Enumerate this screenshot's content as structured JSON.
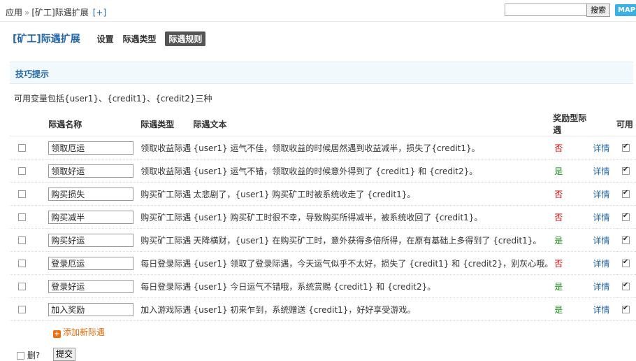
{
  "breadcrumb": {
    "root": "应用",
    "separator": "»",
    "current": "[矿工]际遇扩展",
    "add": "[+]"
  },
  "header": {
    "search_placeholder": "",
    "search_button": "搜索",
    "map_button": "MAP"
  },
  "page": {
    "title": "[矿工]际遇扩展",
    "nav": [
      {
        "label": "设置",
        "active": false
      },
      {
        "label": "际遇类型",
        "active": false
      },
      {
        "label": "际遇规则",
        "active": true
      }
    ]
  },
  "tips": {
    "heading": "技巧提示",
    "text": "可用变量包括{user1}、{credit1}、{credit2}三种"
  },
  "table": {
    "headers": {
      "name": "际遇名称",
      "type": "际遇类型",
      "text": "际遇文本",
      "reward": "奖励型际遇",
      "enabled": "可用"
    },
    "rows": [
      {
        "name": "领取厄运",
        "type": "领取收益际遇",
        "text": "{user1} 运气不佳，领取收益的时候居然遇到收益减半，损失了{credit1}。",
        "reward": "否",
        "reward_color": "#e00000",
        "detail": "详情",
        "enabled": true
      },
      {
        "name": "领取好运",
        "type": "领取收益际遇",
        "text": "{user1} 运气不错，领取收益的时候意外得到了 {credit1} 和 {credit2}。",
        "reward": "是",
        "reward_color": "#1a8a1a",
        "detail": "详情",
        "enabled": true
      },
      {
        "name": "购买损失",
        "type": "购买矿工际遇",
        "text": "太悲剧了，{user1} 购买矿工时被系统收走了 {credit1}。",
        "reward": "否",
        "reward_color": "#e00000",
        "detail": "详情",
        "enabled": true
      },
      {
        "name": "购买减半",
        "type": "购买矿工际遇",
        "text": "{user1} 购买矿工时很不幸，导致购买所得减半，被系统收回了 {credit1}。",
        "reward": "否",
        "reward_color": "#e00000",
        "detail": "详情",
        "enabled": true
      },
      {
        "name": "购买好运",
        "type": "购买矿工际遇",
        "text": "天降横财，{user1} 在购买矿工时，意外获得多倍所得，在原有基础上多得到了 {credit1}。",
        "reward": "是",
        "reward_color": "#1a8a1a",
        "detail": "详情",
        "enabled": true
      },
      {
        "name": "登录厄运",
        "type": "每日登录际遇",
        "text": "{user1} 领取了登录际遇，今天运气似乎不太好，损失了 {credit1} 和 {credit2}，别灰心哦。",
        "reward": "否",
        "reward_color": "#e00000",
        "detail": "详情",
        "enabled": true
      },
      {
        "name": "登录好运",
        "type": "每日登录际遇",
        "text": "{user1} 今日运气不错哦，系统赏赐 {credit1} 和 {credit2}。",
        "reward": "是",
        "reward_color": "#1a8a1a",
        "detail": "详情",
        "enabled": true
      },
      {
        "name": "加入奖励",
        "type": "加入游戏际遇",
        "text": "{user1} 初来乍到，系统赠送 {credit1}，好好享受游戏。",
        "reward": "是",
        "reward_color": "#1a8a1a",
        "detail": "详情",
        "enabled": true
      }
    ]
  },
  "actions": {
    "add_label": "添加新际遇",
    "delete_label": "删?",
    "submit_label": "提交"
  }
}
